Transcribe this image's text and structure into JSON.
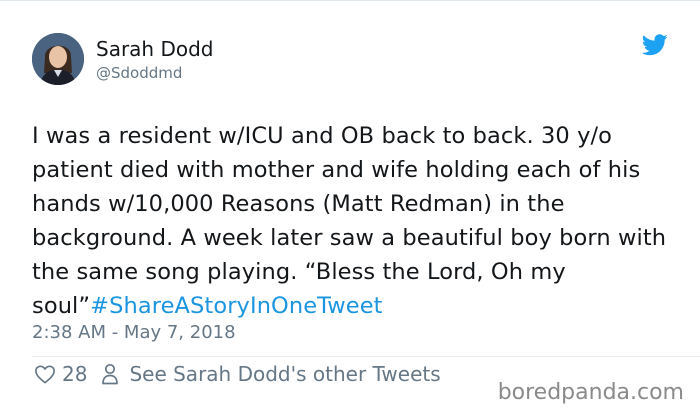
{
  "user": {
    "display_name": "Sarah Dodd",
    "handle": "@Sdoddmd"
  },
  "tweet": {
    "text": "I was a resident w/ICU and OB back to back. 30 y/o patient died with mother and wife holding each of his hands w/10,000 Reasons (Matt Redman) in the background. A week later saw a beautiful boy born with the same song playing. “Bless the Lord, Oh my soul”",
    "hashtag": "#ShareAStoryInOneTweet",
    "timestamp": "2:38 AM - May 7, 2018"
  },
  "actions": {
    "like_icon": "heart-icon",
    "like_count": "28",
    "profile_icon": "person-icon",
    "profile_link": "See Sarah Dodd's other Tweets"
  },
  "watermark": "boredpanda.com",
  "colors": {
    "link": "#1b95e0",
    "twitter_blue": "#1da1f2",
    "muted": "#657786"
  }
}
